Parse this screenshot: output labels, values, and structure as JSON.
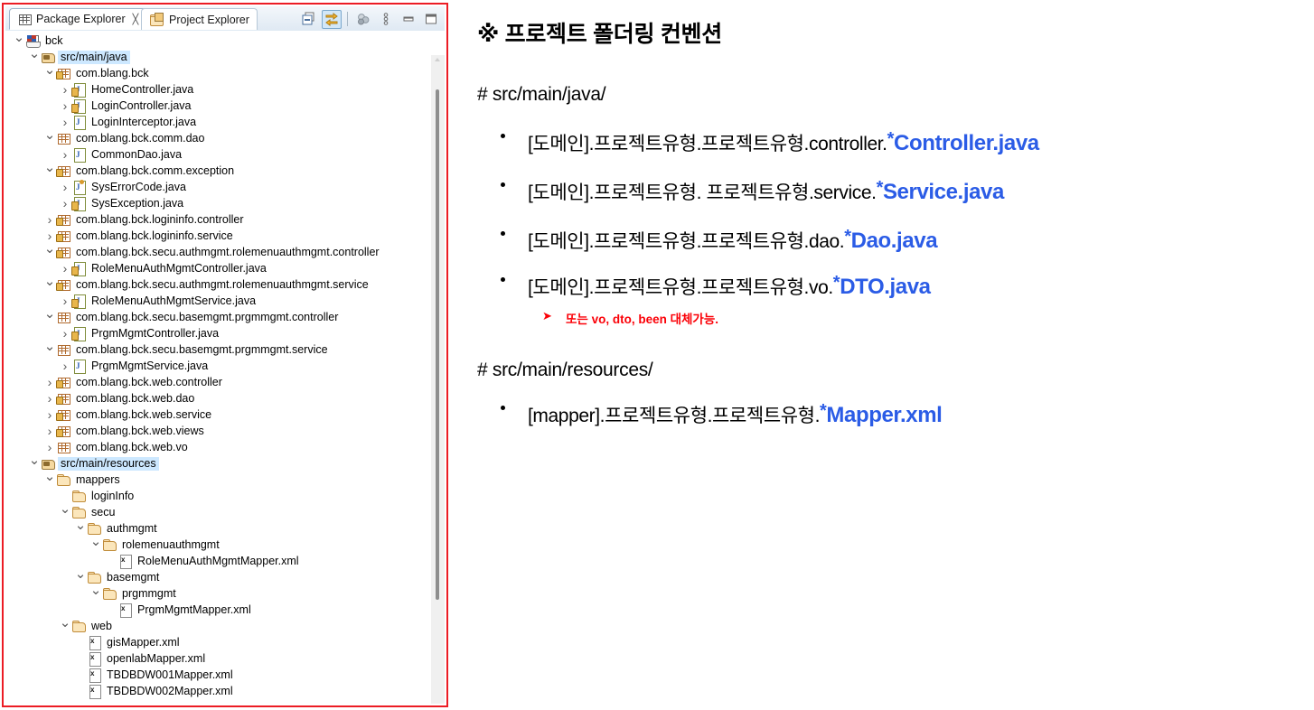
{
  "explorer": {
    "tabs": [
      {
        "label": "Package Explorer",
        "icon": "package-explorer-icon",
        "active": true,
        "closable": true
      },
      {
        "label": "Project Explorer",
        "icon": "project-explorer-icon",
        "active": false,
        "closable": false
      }
    ],
    "toolbar": [
      {
        "name": "collapse-all-icon",
        "selected": false
      },
      {
        "name": "link-with-editor-icon",
        "selected": true
      },
      {
        "name": "view-menu-filters-icon",
        "selected": false
      },
      {
        "name": "view-menu-icon",
        "selected": false
      },
      {
        "name": "minimize-icon",
        "selected": false
      },
      {
        "name": "maximize-icon",
        "selected": false
      }
    ],
    "tree": [
      {
        "label": "bck",
        "depth": 0,
        "icon": "java-project-icon",
        "state": "open",
        "selected": false
      },
      {
        "label": "src/main/java",
        "depth": 1,
        "icon": "source-folder-icon",
        "state": "open",
        "selected": true
      },
      {
        "label": "com.blang.bck",
        "depth": 2,
        "icon": "package-locked-icon",
        "state": "open",
        "selected": false
      },
      {
        "label": "HomeController.java",
        "depth": 3,
        "icon": "java-class-locked-icon",
        "state": "closed",
        "selected": false
      },
      {
        "label": "LoginController.java",
        "depth": 3,
        "icon": "java-class-locked-icon",
        "state": "closed",
        "selected": false
      },
      {
        "label": "LoginInterceptor.java",
        "depth": 3,
        "icon": "java-class-icon",
        "state": "closed",
        "selected": false
      },
      {
        "label": "com.blang.bck.comm.dao",
        "depth": 2,
        "icon": "package-icon",
        "state": "open",
        "selected": false
      },
      {
        "label": "CommonDao.java",
        "depth": 3,
        "icon": "java-class-icon",
        "state": "closed",
        "selected": false
      },
      {
        "label": "com.blang.bck.comm.exception",
        "depth": 2,
        "icon": "package-locked-icon",
        "state": "open",
        "selected": false
      },
      {
        "label": "SysErrorCode.java",
        "depth": 3,
        "icon": "java-enum-icon",
        "state": "closed",
        "selected": false
      },
      {
        "label": "SysException.java",
        "depth": 3,
        "icon": "java-class-locked-icon",
        "state": "closed",
        "selected": false
      },
      {
        "label": "com.blang.bck.logininfo.controller",
        "depth": 2,
        "icon": "package-locked-icon",
        "state": "closed",
        "selected": false
      },
      {
        "label": "com.blang.bck.logininfo.service",
        "depth": 2,
        "icon": "package-locked-icon",
        "state": "closed",
        "selected": false
      },
      {
        "label": "com.blang.bck.secu.authmgmt.rolemenuauthmgmt.controller",
        "depth": 2,
        "icon": "package-locked-icon",
        "state": "open",
        "selected": false
      },
      {
        "label": "RoleMenuAuthMgmtController.java",
        "depth": 3,
        "icon": "java-class-locked-icon",
        "state": "closed",
        "selected": false
      },
      {
        "label": "com.blang.bck.secu.authmgmt.rolemenuauthmgmt.service",
        "depth": 2,
        "icon": "package-locked-icon",
        "state": "open",
        "selected": false
      },
      {
        "label": "RoleMenuAuthMgmtService.java",
        "depth": 3,
        "icon": "java-class-locked-icon",
        "state": "closed",
        "selected": false
      },
      {
        "label": "com.blang.bck.secu.basemgmt.prgmmgmt.controller",
        "depth": 2,
        "icon": "package-icon",
        "state": "open",
        "selected": false
      },
      {
        "label": "PrgmMgmtController.java",
        "depth": 3,
        "icon": "java-class-locked-icon",
        "state": "closed",
        "selected": false
      },
      {
        "label": "com.blang.bck.secu.basemgmt.prgmmgmt.service",
        "depth": 2,
        "icon": "package-icon",
        "state": "open",
        "selected": false
      },
      {
        "label": "PrgmMgmtService.java",
        "depth": 3,
        "icon": "java-class-icon",
        "state": "closed",
        "selected": false
      },
      {
        "label": "com.blang.bck.web.controller",
        "depth": 2,
        "icon": "package-locked-icon",
        "state": "closed",
        "selected": false
      },
      {
        "label": "com.blang.bck.web.dao",
        "depth": 2,
        "icon": "package-locked-icon",
        "state": "closed",
        "selected": false
      },
      {
        "label": "com.blang.bck.web.service",
        "depth": 2,
        "icon": "package-locked-icon",
        "state": "closed",
        "selected": false
      },
      {
        "label": "com.blang.bck.web.views",
        "depth": 2,
        "icon": "package-locked-icon",
        "state": "closed",
        "selected": false
      },
      {
        "label": "com.blang.bck.web.vo",
        "depth": 2,
        "icon": "package-icon",
        "state": "closed",
        "selected": false
      },
      {
        "label": "src/main/resources",
        "depth": 1,
        "icon": "source-folder-icon",
        "state": "open",
        "selected": true
      },
      {
        "label": "mappers",
        "depth": 2,
        "icon": "folder-icon",
        "state": "open",
        "selected": false
      },
      {
        "label": "loginInfo",
        "depth": 3,
        "icon": "folder-icon",
        "state": "none",
        "selected": false
      },
      {
        "label": "secu",
        "depth": 3,
        "icon": "folder-icon",
        "state": "open",
        "selected": false
      },
      {
        "label": "authmgmt",
        "depth": 4,
        "icon": "folder-icon",
        "state": "open",
        "selected": false
      },
      {
        "label": "rolemenuauthmgmt",
        "depth": 5,
        "icon": "folder-icon",
        "state": "open",
        "selected": false
      },
      {
        "label": "RoleMenuAuthMgmtMapper.xml",
        "depth": 6,
        "icon": "xml-file-icon",
        "state": "none",
        "selected": false
      },
      {
        "label": "basemgmt",
        "depth": 4,
        "icon": "folder-icon",
        "state": "open",
        "selected": false
      },
      {
        "label": "prgmmgmt",
        "depth": 5,
        "icon": "folder-icon",
        "state": "open",
        "selected": false
      },
      {
        "label": "PrgmMgmtMapper.xml",
        "depth": 6,
        "icon": "xml-file-icon",
        "state": "none",
        "selected": false
      },
      {
        "label": "web",
        "depth": 3,
        "icon": "folder-icon",
        "state": "open",
        "selected": false
      },
      {
        "label": "gisMapper.xml",
        "depth": 4,
        "icon": "xml-file-icon",
        "state": "none",
        "selected": false
      },
      {
        "label": "openlabMapper.xml",
        "depth": 4,
        "icon": "xml-file-icon",
        "state": "none",
        "selected": false
      },
      {
        "label": "TBDBDW001Mapper.xml",
        "depth": 4,
        "icon": "xml-file-icon",
        "state": "none",
        "selected": false
      },
      {
        "label": "TBDBDW002Mapper.xml",
        "depth": 4,
        "icon": "xml-file-icon",
        "state": "none",
        "selected": false
      }
    ]
  },
  "notes": {
    "title": "※ 프로젝트 폴더링 컨벤션",
    "sections": [
      {
        "heading": "# src/main/java/",
        "items": [
          {
            "prefix": "[도메인].프로젝트유형.프로젝트유형.controller.",
            "star": "*",
            "highlight": "Controller.java"
          },
          {
            "prefix": "[도메인].프로젝트유형. 프로젝트유형.service.",
            "star": "*",
            "highlight": "Service.java"
          },
          {
            "prefix": "[도메인].프로젝트유형.프로젝트유형.dao.",
            "star": "*",
            "highlight": "Dao.java"
          },
          {
            "prefix": "[도메인].프로젝트유형.프로젝트유형.vo.",
            "star": "*",
            "highlight": "DTO.java"
          }
        ],
        "subnote": "또는 vo, dto, been 대체가능."
      },
      {
        "heading": "# src/main/resources/",
        "items": [
          {
            "prefix": "[mapper].프로젝트유형.프로젝트유형.",
            "star": "*",
            "highlight": "Mapper.xml"
          }
        ]
      }
    ],
    "colors": {
      "highlight": "#2b5ce6",
      "subnote": "#fb0007",
      "panel_border": "#ec1c24"
    }
  }
}
